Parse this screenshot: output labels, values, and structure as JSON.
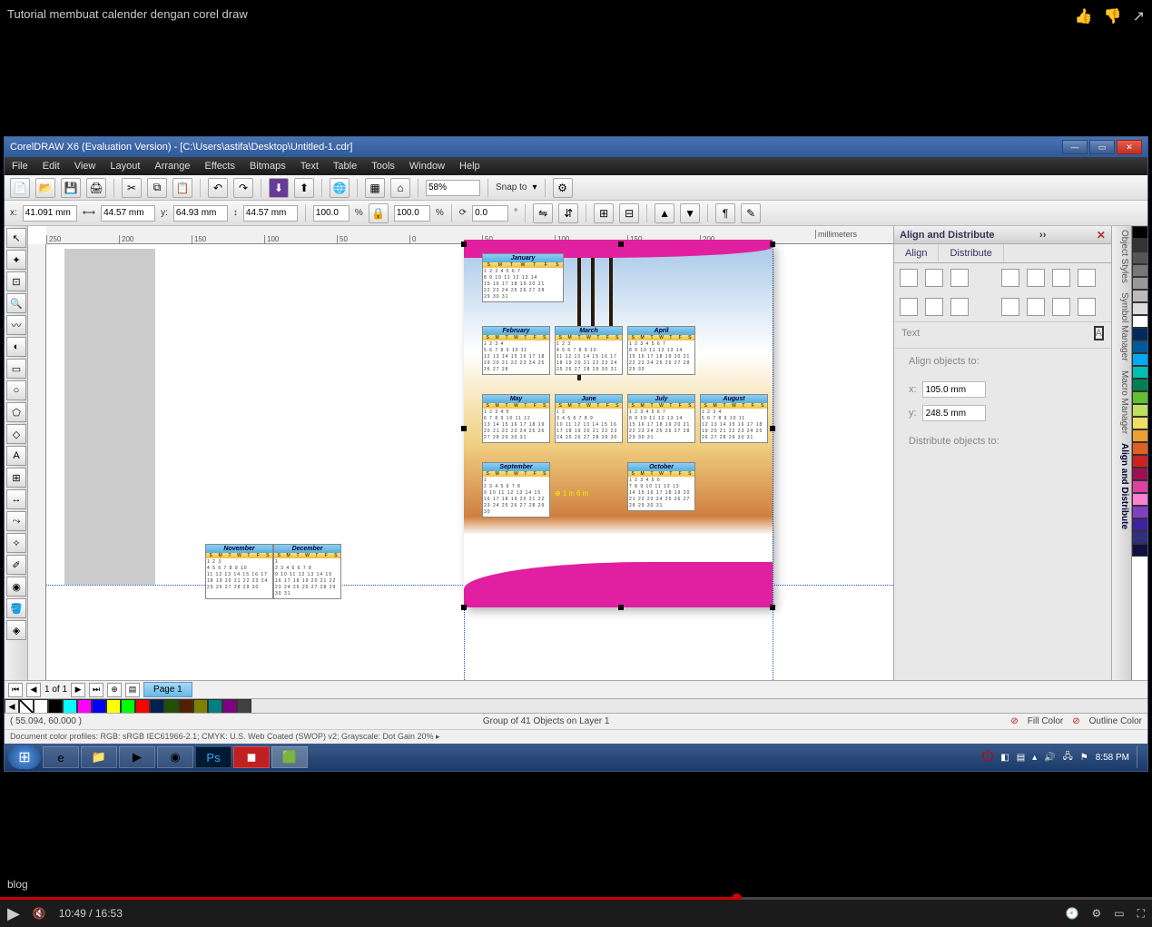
{
  "video": {
    "title": "Tutorial membuat calender dengan corel draw",
    "blog_label": "blog",
    "time_current": "10:49",
    "time_total": "16:53"
  },
  "corel": {
    "title": "CorelDRAW X6 (Evaluation Version) - [C:\\Users\\astifa\\Desktop\\Untitled-1.cdr]",
    "menus": [
      "File",
      "Edit",
      "View",
      "Layout",
      "Arrange",
      "Effects",
      "Bitmaps",
      "Text",
      "Table",
      "Tools",
      "Window",
      "Help"
    ],
    "toolbar": {
      "zoom": "58%",
      "snap": "Snap to"
    },
    "props": {
      "x": "41.091 mm",
      "y": "64.93 mm",
      "w": "44.57 mm",
      "h": "44.57 mm",
      "sx": "100.0",
      "sy": "100.0",
      "rot": "0.0"
    },
    "ruler_marks": [
      "250",
      "200",
      "150",
      "100",
      "50",
      "0",
      "50",
      "100",
      "150",
      "200"
    ],
    "ruler_unit": "millimeters",
    "page": {
      "info": "1 of 1",
      "tab": "Page 1"
    },
    "status": {
      "coord": "( 55.094, 60.000 )",
      "selection": "Group of 41 Objects on Layer 1",
      "fill": "Fill Color",
      "outline": "Outline Color",
      "profiles": "Document color profiles: RGB: sRGB IEC61966-2.1; CMYK: U.S. Web Coated (SWOP) v2; Grayscale: Dot Gain 20% ▸"
    },
    "docker": {
      "title": "Align and Distribute",
      "tab_align": "Align",
      "tab_dist": "Distribute",
      "text_lbl": "Text",
      "align_to": "Align objects to:",
      "dist_to": "Distribute objects to:",
      "v1": "105.0 mm",
      "v2": "248.5 mm"
    },
    "vtabs": [
      "Object Styles",
      "Symbol Manager",
      "Macro Manager",
      "Align and Distribute"
    ],
    "months": [
      "January",
      "February",
      "March",
      "April",
      "May",
      "June",
      "July",
      "August",
      "September",
      "October",
      "November",
      "December"
    ],
    "dayrow": [
      "S",
      "M",
      "T",
      "W",
      "T",
      "F",
      "S"
    ],
    "drag_label": "⊕ 1 in 6 in"
  },
  "palette": [
    "#000",
    "#333",
    "#555",
    "#777",
    "#999",
    "#bbb",
    "#ddd",
    "#fff",
    "#002a5a",
    "#005a9a",
    "#00aaee",
    "#00c0b0",
    "#008050",
    "#60c030",
    "#c0e060",
    "#f0e060",
    "#f0a030",
    "#e06020",
    "#d02020",
    "#a01050",
    "#e040a0",
    "#ff80d0",
    "#8040c0",
    "#4020a0",
    "#303080",
    "#101040"
  ],
  "mini_palette": [
    "#fff",
    "#000",
    "#00ffff",
    "#ff00ff",
    "#0000ff",
    "#ffff00",
    "#00ff00",
    "#ff0000",
    "#002050",
    "#205000",
    "#502000",
    "#808000",
    "#008080",
    "#800080",
    "#404040"
  ],
  "windows": {
    "time": "8:58 PM"
  }
}
